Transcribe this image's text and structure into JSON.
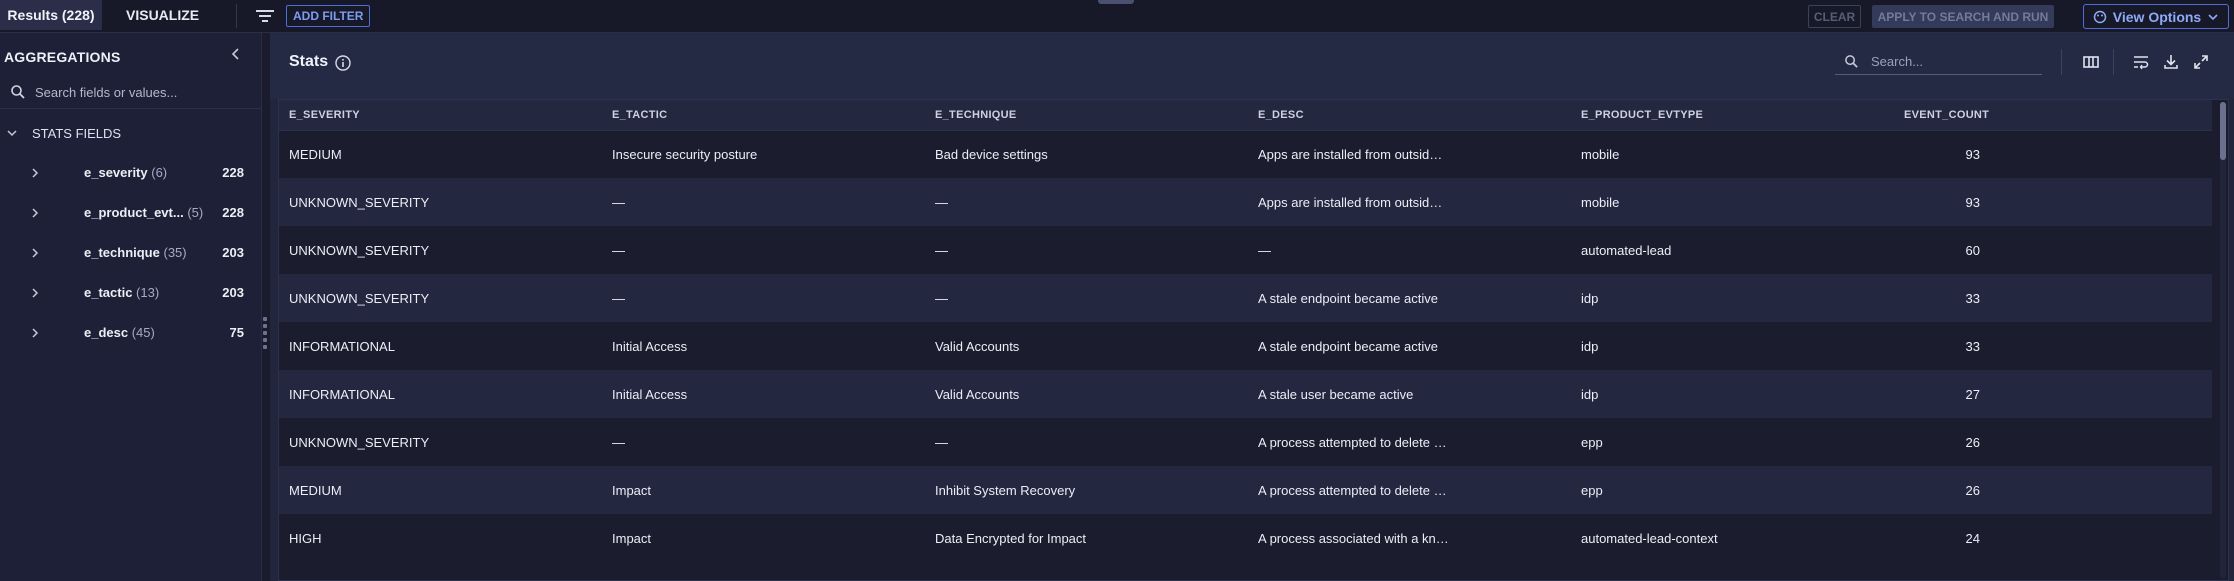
{
  "topbar": {
    "results_tab": "Results (228)",
    "visualize_tab": "VISUALIZE",
    "add_filter": "ADD FILTER",
    "clear": "CLEAR",
    "apply": "APPLY TO SEARCH AND RUN",
    "view_options": "View Options"
  },
  "sidebar": {
    "title": "AGGREGATIONS",
    "search_placeholder": "Search fields or values...",
    "section_label": "STATS FIELDS",
    "fields": [
      {
        "name": "e_severity",
        "count": "(6)",
        "total": "228"
      },
      {
        "name": "e_product_evt...",
        "count": "(5)",
        "total": "228"
      },
      {
        "name": "e_technique",
        "count": "(35)",
        "total": "203"
      },
      {
        "name": "e_tactic",
        "count": "(13)",
        "total": "203"
      },
      {
        "name": "e_desc",
        "count": "(45)",
        "total": "75"
      }
    ]
  },
  "main": {
    "title": "Stats",
    "search_placeholder": "Search...",
    "columns": [
      "E_SEVERITY",
      "E_TACTIC",
      "E_TECHNIQUE",
      "E_DESC",
      "E_PRODUCT_EVTYPE",
      "EVENT_COUNT"
    ],
    "rows": [
      [
        "MEDIUM",
        "Insecure security posture",
        "Bad device settings",
        "Apps are installed from outside the PlayStore",
        "mobile",
        "93"
      ],
      [
        "UNKNOWN_SEVERITY",
        "—",
        "—",
        "Apps are installed from outside the PlayStore",
        "mobile",
        "93"
      ],
      [
        "UNKNOWN_SEVERITY",
        "—",
        "—",
        "—",
        "automated-lead",
        "60"
      ],
      [
        "UNKNOWN_SEVERITY",
        "—",
        "—",
        "A stale endpoint became active",
        "idp",
        "33"
      ],
      [
        "INFORMATIONAL",
        "Initial Access",
        "Valid Accounts",
        "A stale endpoint became active",
        "idp",
        "33"
      ],
      [
        "INFORMATIONAL",
        "Initial Access",
        "Valid Accounts",
        "A stale user became active",
        "idp",
        "27"
      ],
      [
        "UNKNOWN_SEVERITY",
        "—",
        "—",
        "A process attempted to delete a Volume Shadow Copy",
        "epp",
        "26"
      ],
      [
        "MEDIUM",
        "Impact",
        "Inhibit System Recovery",
        "A process attempted to delete a Volume Shadow Copy",
        "epp",
        "26"
      ],
      [
        "HIGH",
        "Impact",
        "Data Encrypted for Impact",
        "A process associated with a known ransomware",
        "automated-lead-context",
        "24"
      ]
    ]
  },
  "icons": {
    "filter": "filter-lines-icon",
    "collapse": "chevron-left-icon",
    "info": "info-circle-icon",
    "columns": "columns-icon",
    "wrap": "wrap-text-icon",
    "download": "download-icon",
    "expand": "expand-icon"
  }
}
